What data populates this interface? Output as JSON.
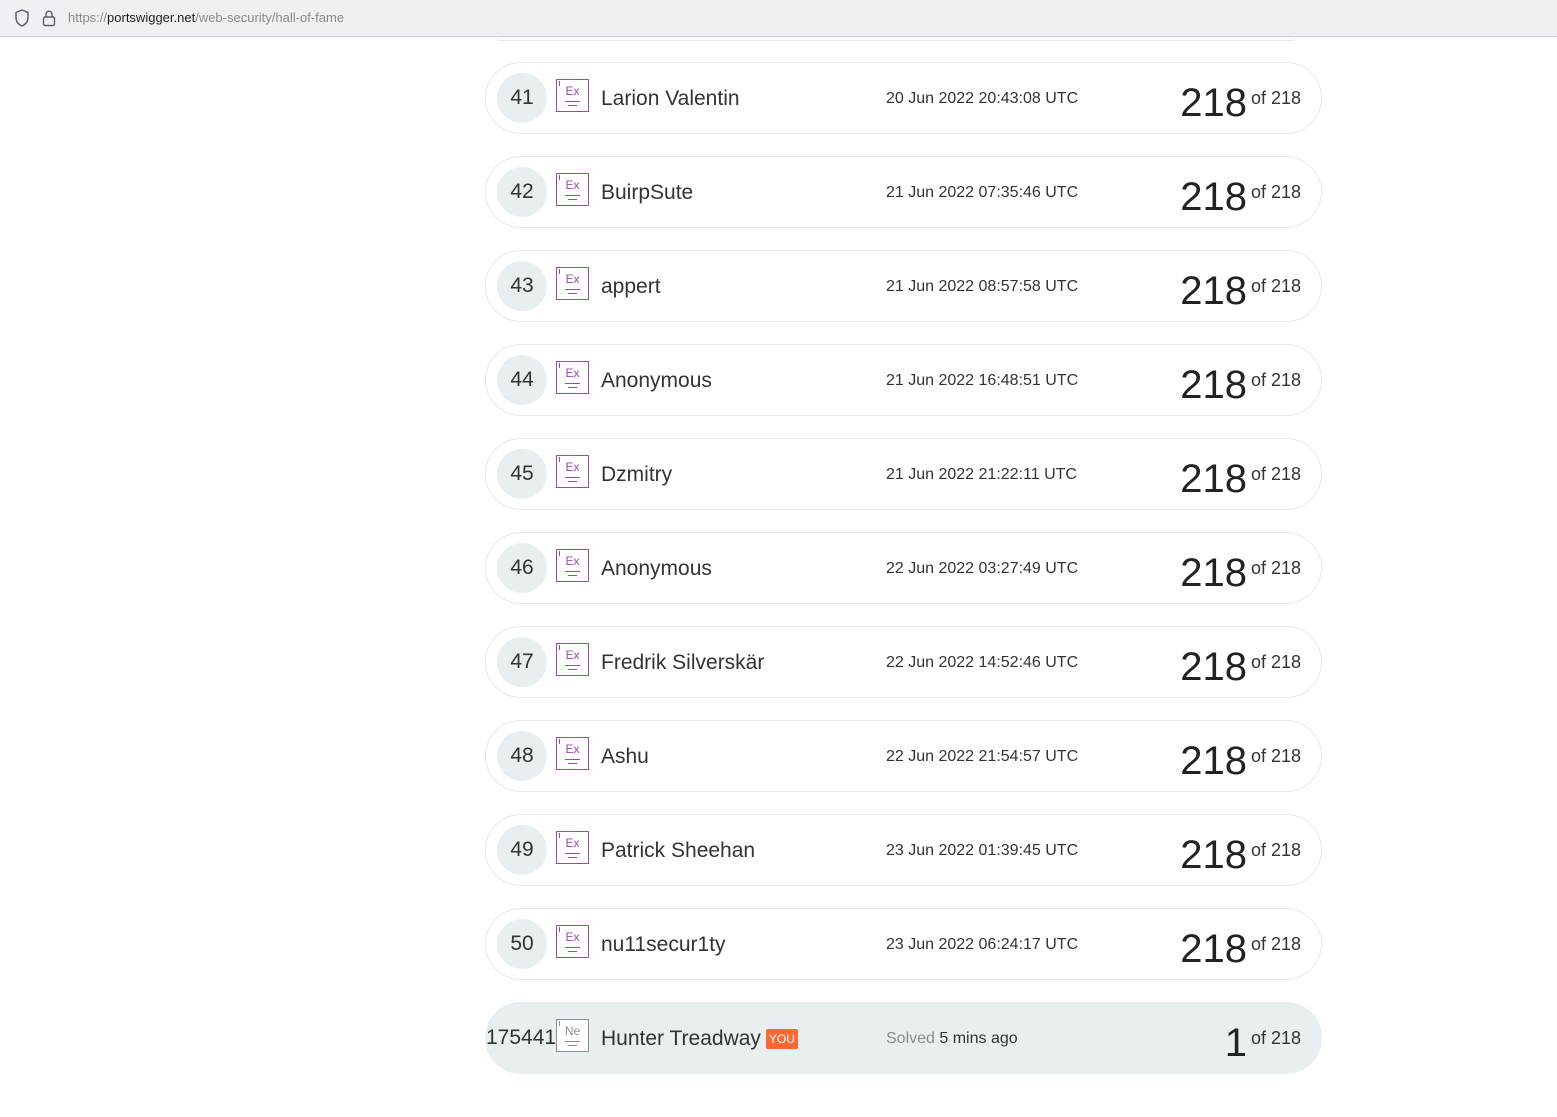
{
  "browser": {
    "url_scheme": "https://",
    "url_host": "portswigger.net",
    "url_path": "/web-security/hall-of-fame"
  },
  "colors": {
    "expert_badge": "#9b4aa8",
    "novice_badge": "#8f8f8f",
    "you_tag": "#ff6633",
    "row_highlight": "#e9eef0"
  },
  "rows": [
    {
      "rank": "41",
      "badge_icon": "expert-badge-icon",
      "badge_symbol": "Ex",
      "name": "Larion Valentin",
      "date": "20 Jun 2022 20:43:08 UTC",
      "solved": "218",
      "of_total": "of 218"
    },
    {
      "rank": "42",
      "badge_icon": "expert-badge-icon",
      "badge_symbol": "Ex",
      "name": "BuirpSute",
      "date": "21 Jun 2022 07:35:46 UTC",
      "solved": "218",
      "of_total": "of 218"
    },
    {
      "rank": "43",
      "badge_icon": "expert-badge-icon",
      "badge_symbol": "Ex",
      "name": "appert",
      "date": "21 Jun 2022 08:57:58 UTC",
      "solved": "218",
      "of_total": "of 218"
    },
    {
      "rank": "44",
      "badge_icon": "expert-badge-icon",
      "badge_symbol": "Ex",
      "name": "Anonymous",
      "date": "21 Jun 2022 16:48:51 UTC",
      "solved": "218",
      "of_total": "of 218"
    },
    {
      "rank": "45",
      "badge_icon": "expert-badge-icon",
      "badge_symbol": "Ex",
      "name": "Dzmitry",
      "date": "21 Jun 2022 21:22:11 UTC",
      "solved": "218",
      "of_total": "of 218"
    },
    {
      "rank": "46",
      "badge_icon": "expert-badge-icon",
      "badge_symbol": "Ex",
      "name": "Anonymous",
      "date": "22 Jun 2022 03:27:49 UTC",
      "solved": "218",
      "of_total": "of 218"
    },
    {
      "rank": "47",
      "badge_icon": "expert-badge-icon",
      "badge_symbol": "Ex",
      "name": "Fredrik Silverskär",
      "date": "22 Jun 2022 14:52:46 UTC",
      "solved": "218",
      "of_total": "of 218"
    },
    {
      "rank": "48",
      "badge_icon": "expert-badge-icon",
      "badge_symbol": "Ex",
      "name": "Ashu",
      "date": "22 Jun 2022 21:54:57 UTC",
      "solved": "218",
      "of_total": "of 218"
    },
    {
      "rank": "49",
      "badge_icon": "expert-badge-icon",
      "badge_symbol": "Ex",
      "name": "Patrick Sheehan",
      "date": "23 Jun 2022 01:39:45 UTC",
      "solved": "218",
      "of_total": "of 218"
    },
    {
      "rank": "50",
      "badge_icon": "expert-badge-icon",
      "badge_symbol": "Ex",
      "name": "nu11secur1ty",
      "date": "23 Jun 2022 06:24:17 UTC",
      "solved": "218",
      "of_total": "of 218"
    }
  ],
  "current_user": {
    "rank": "175441",
    "badge_icon": "novice-badge-icon",
    "badge_symbol": "Ne",
    "name": "Hunter Treadway",
    "you_label": "YOU",
    "solved_label": "Solved",
    "solved_time": "5 mins ago",
    "solved": "1",
    "of_total": "of 218"
  }
}
